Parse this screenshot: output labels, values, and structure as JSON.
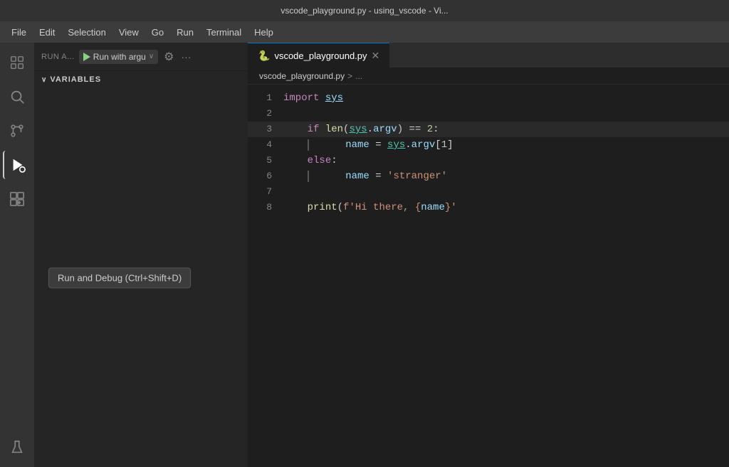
{
  "titleBar": {
    "text": "vscode_playground.py - using_vscode - Vi..."
  },
  "menuBar": {
    "items": [
      "File",
      "Edit",
      "Selection",
      "View",
      "Go",
      "Run",
      "Terminal",
      "Help"
    ]
  },
  "activityBar": {
    "icons": [
      {
        "name": "explorer-icon",
        "symbol": "📋"
      },
      {
        "name": "search-icon",
        "symbol": "🔍"
      },
      {
        "name": "source-control-icon",
        "symbol": "⎇"
      },
      {
        "name": "run-debug-icon",
        "symbol": "▶"
      },
      {
        "name": "extensions-icon",
        "symbol": "⊞"
      },
      {
        "name": "flask-icon",
        "symbol": "⚗"
      }
    ]
  },
  "sidebar": {
    "runLabel": "RUN A...",
    "runDropdown": "Run with argu",
    "variablesHeader": "VARIABLES",
    "tooltip": "Run and Debug (Ctrl+Shift+D)"
  },
  "editor": {
    "tab": {
      "filename": "vscode_playground.py",
      "icon": "🐍"
    },
    "breadcrumb": {
      "filename": "vscode_playground.py",
      "separator": ">",
      "more": "..."
    },
    "lines": [
      {
        "num": "1",
        "content": "import sys",
        "tokens": [
          {
            "type": "kw",
            "text": "import"
          },
          {
            "type": "plain",
            "text": " "
          },
          {
            "type": "var underline",
            "text": "sys"
          }
        ]
      },
      {
        "num": "2",
        "content": ""
      },
      {
        "num": "3",
        "content": "    if len(sys.argv) == 2:",
        "highlight": true
      },
      {
        "num": "4",
        "content": "        name = sys.argv[1]"
      },
      {
        "num": "5",
        "content": "    else:"
      },
      {
        "num": "6",
        "content": "        name = 'stranger'"
      },
      {
        "num": "7",
        "content": ""
      },
      {
        "num": "8",
        "content": "    print(f'Hi there, {name}'"
      }
    ]
  }
}
